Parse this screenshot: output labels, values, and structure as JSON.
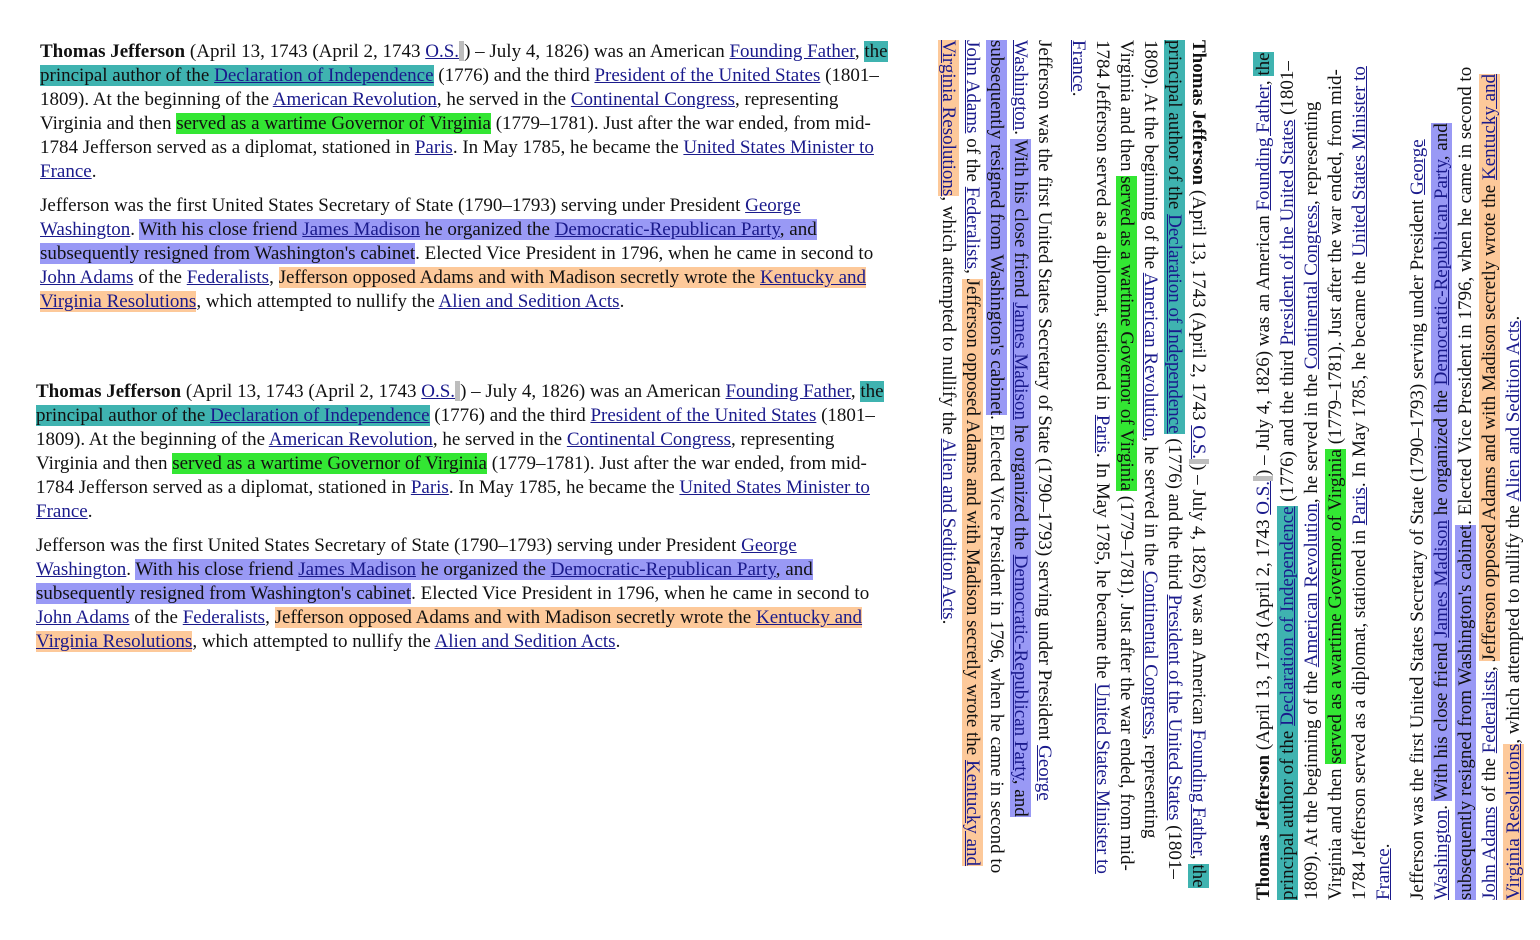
{
  "article": {
    "p1": {
      "name": "Thomas Jefferson",
      "t1": " (April 13, 1743 (April 2, 1743 ",
      "os": "O.S.",
      "t2": ") – July 4, 1826) was an American ",
      "founding_father": "Founding Father",
      "t3": ", ",
      "hl_author": "the principal author of the ",
      "declaration": "Declaration of Independence",
      "t4": " (1776) and the third ",
      "president": "President of the United States",
      "t5": " (1801–1809). At the beginning of the ",
      "revolution": "American Revolution",
      "t6": ", he served in the ",
      "congress": "Continental Congress",
      "t7": ", representing Virginia and then ",
      "hl_governor": "served as a wartime Governor of Virginia",
      "t8": " (1779–1781). Just after the war ended, from mid-1784 Jefferson served as a diplomat, stationed in ",
      "paris": "Paris",
      "t9": ". In May 1785, he became the ",
      "minister": "United States Minister to France",
      "t10": "."
    },
    "p2": {
      "t1": "Jefferson was the first United States Secretary of State (1790–1793) serving under President ",
      "washington": "George Washington",
      "t2": ". ",
      "hl_a1": "With his close friend ",
      "madison": "James Madison",
      "hl_a2": " he organized the ",
      "drp": "Democratic-Republican Party",
      "hl_a3": ", and subsequently resigned from Washington's cabinet",
      "t3": ". Elected Vice President in 1796, when he came in second to ",
      "adams": "John Adams",
      "t4": " of the ",
      "federalists": "Federalists",
      "t5": ", ",
      "hl_b1": "Jefferson opposed Adams and with Madison secretly wrote the ",
      "kvr": "Kentucky and Virginia Resolutions",
      "t6": ", which attempted to nullify the ",
      "alien": "Alien and Sedition Acts",
      "t7": "."
    }
  },
  "colors": {
    "link": "#1a1a8c",
    "highlight_teal": "#3fb3b0",
    "highlight_green": "#33e633",
    "highlight_purple": "#9999f5",
    "highlight_peach": "#fdc99a"
  }
}
